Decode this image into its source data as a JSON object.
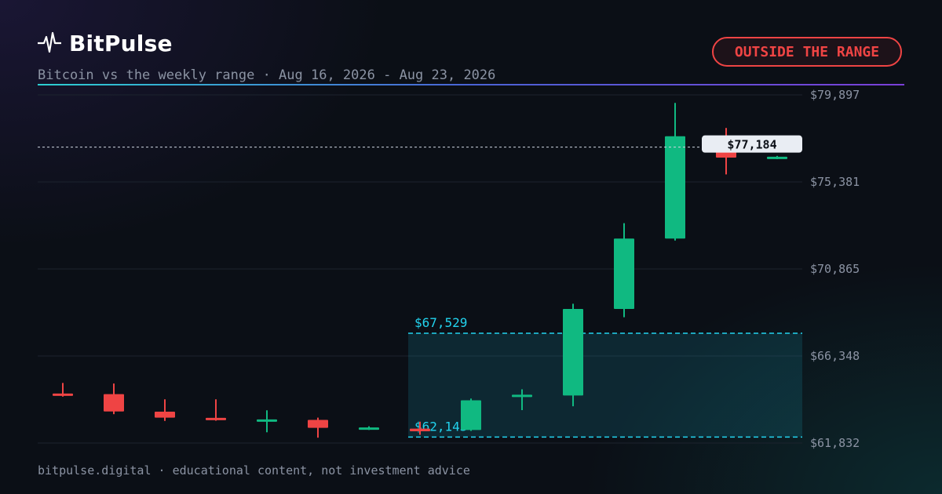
{
  "brand": {
    "name": "BitPulse",
    "icon": "pulse-icon"
  },
  "subtitle": "Bitcoin vs the weekly range · Aug 16, 2026 - Aug 23, 2026",
  "badge": {
    "label": "OUTSIDE THE RANGE",
    "color": "#ef4444"
  },
  "footer": "bitpulse.digital · educational content, not investment advice",
  "colors": {
    "up": "#10b981",
    "down": "#ef4444",
    "range": "#22d3ee",
    "grid": "#1c232e",
    "axis_text": "#8b93a3"
  },
  "chart_data": {
    "type": "candlestick",
    "ylim": [
      61832,
      79897
    ],
    "yticks": [
      79897,
      75381,
      70865,
      66348,
      61832
    ],
    "ytick_labels": [
      "$79,897",
      "$75,381",
      "$70,865",
      "$66,348",
      "$61,832"
    ],
    "candles": [
      {
        "open": 64400,
        "high": 64950,
        "low": 64240,
        "close": 64370
      },
      {
        "open": 64370,
        "high": 64920,
        "low": 63330,
        "close": 63470
      },
      {
        "open": 63460,
        "high": 64100,
        "low": 62980,
        "close": 63150
      },
      {
        "open": 63140,
        "high": 64100,
        "low": 62990,
        "close": 63060
      },
      {
        "open": 63030,
        "high": 63530,
        "low": 62390,
        "close": 63060
      },
      {
        "open": 63030,
        "high": 63150,
        "low": 62110,
        "close": 62620
      },
      {
        "open": 62620,
        "high": 62700,
        "low": 62510,
        "close": 62640
      },
      {
        "open": 62580,
        "high": 62940,
        "low": 62260,
        "close": 62440
      },
      {
        "open": 62510,
        "high": 64140,
        "low": 62460,
        "close": 64050
      },
      {
        "open": 64220,
        "high": 64620,
        "low": 63540,
        "close": 64340
      },
      {
        "open": 64300,
        "high": 69060,
        "low": 63740,
        "close": 68790
      },
      {
        "open": 68790,
        "high": 73240,
        "low": 68360,
        "close": 72440
      },
      {
        "open": 72440,
        "high": 79480,
        "low": 72340,
        "close": 77750
      },
      {
        "open": 77750,
        "high": 78180,
        "low": 75770,
        "close": 76640
      },
      {
        "open": 76630,
        "high": 76730,
        "low": 76560,
        "close": 76690
      }
    ],
    "range": {
      "upper": 67529,
      "lower": 62143,
      "upper_label": "$67,529",
      "lower_label": "$62,143",
      "start_index": 7
    },
    "current": {
      "value": 77184,
      "label": "$77,184"
    }
  }
}
